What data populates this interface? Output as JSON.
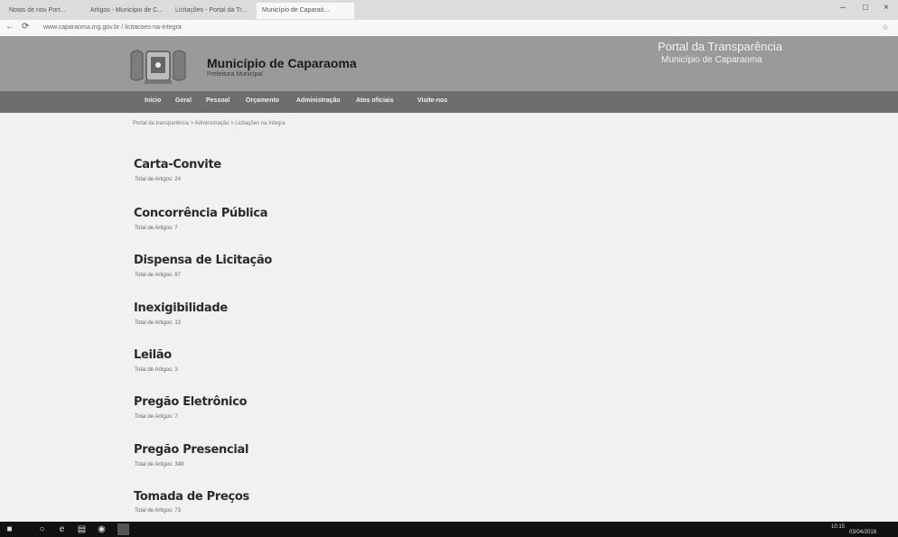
{
  "browser": {
    "tabs": [
      "Notas de nou Port...",
      "Artigos - Municipio de C...",
      "Licitações - Portal da Tr...",
      "Município de Caparaó..."
    ],
    "url": "www.caparaoma.mg.gov.br / licitacoes-na-integra",
    "window_controls": [
      "–",
      "□",
      "×"
    ]
  },
  "header": {
    "municipality_name": "Município de Caparaoma",
    "subtitle": "Prefeitura Municipal",
    "portal_title": "Portal da Transparência",
    "portal_subtitle": "Município de Caparaoma"
  },
  "nav": {
    "items": [
      "Início",
      "Geral",
      "Pessoal",
      "Orçamento",
      "Administração",
      "Atos oficiais",
      "Visite-nos"
    ]
  },
  "breadcrumb": "Portal da transparência > Administração > Licitações na íntegra",
  "categories": [
    {
      "title": "Carta-Convite",
      "count": "Total de Artigos: 24"
    },
    {
      "title": "Concorrência Pública",
      "count": "Total de Artigos: 7"
    },
    {
      "title": "Dispensa de Licitação",
      "count": "Total de Artigos: 97"
    },
    {
      "title": "Inexigibilidade",
      "count": "Total de Artigos: 13"
    },
    {
      "title": "Leilão",
      "count": "Total de Artigos: 3"
    },
    {
      "title": "Pregão Eletrônico",
      "count": "Total de Artigos: 7"
    },
    {
      "title": "Pregão Presencial",
      "count": "Total de Artigos: 349"
    },
    {
      "title": "Tomada de Preços",
      "count": "Total de Artigos: 73"
    }
  ],
  "taskbar": {
    "clock": "10:15",
    "date": "03/04/2018"
  },
  "icons": {
    "back": "←",
    "refresh": "⟳",
    "star": "☆",
    "start": "■",
    "search": "○",
    "edge": "e",
    "explorer": "▤",
    "chrome": "◉"
  }
}
